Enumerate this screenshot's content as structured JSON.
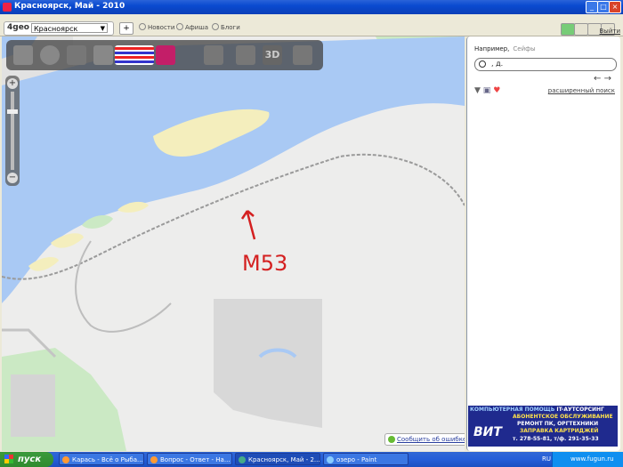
{
  "window": {
    "title": "Красноярск, Май - 2010",
    "controls": [
      "minimize",
      "maximize",
      "close"
    ]
  },
  "toolbar": {
    "logo": "4geo",
    "city": "Красноярск",
    "news": "Новости",
    "poster": "Афиша",
    "blogs": "Блоги",
    "help": "Выйти"
  },
  "map": {
    "annotation": "М53",
    "report_link": "Сообщить об ошибке",
    "mode_3d": "3D",
    "zoom_in": "+",
    "zoom_out": "−",
    "colors": {
      "water": "#a9c9f4",
      "land": "#ededec",
      "sand": "#f4eebd",
      "green": "#cbe9c4",
      "annotation": "#d42020"
    }
  },
  "panel": {
    "hint": "Например,",
    "hint_link": "Сейфы",
    "search_value": ", д.",
    "advanced": "расширенный поиск",
    "ad": {
      "line1a": "КОМПЬЮТЕРНАЯ ПОМОЩЬ",
      "line1b": "IT-АУТСОРСИНГ",
      "line2": "АБОНЕНТСКОЕ ОБСЛУЖИВАНИЕ",
      "line3": "РЕМОНТ ПК, ОРГТЕХНИКИ",
      "line4": "ЗАПРАВКА КАРТРИДЖЕЙ",
      "line5": "т. 278-55-81, т/ф. 291-35-33",
      "brand": "ВИТ"
    }
  },
  "taskbar": {
    "start": "пуск",
    "tasks": [
      {
        "label": "Карась - Всё о Рыба..."
      },
      {
        "label": "Вопрос - Ответ - На..."
      },
      {
        "label": "Красноярск, Май - 2..."
      },
      {
        "label": "озеро - Paint"
      }
    ],
    "lang": "RU",
    "watermark": "www.fugun.ru"
  }
}
